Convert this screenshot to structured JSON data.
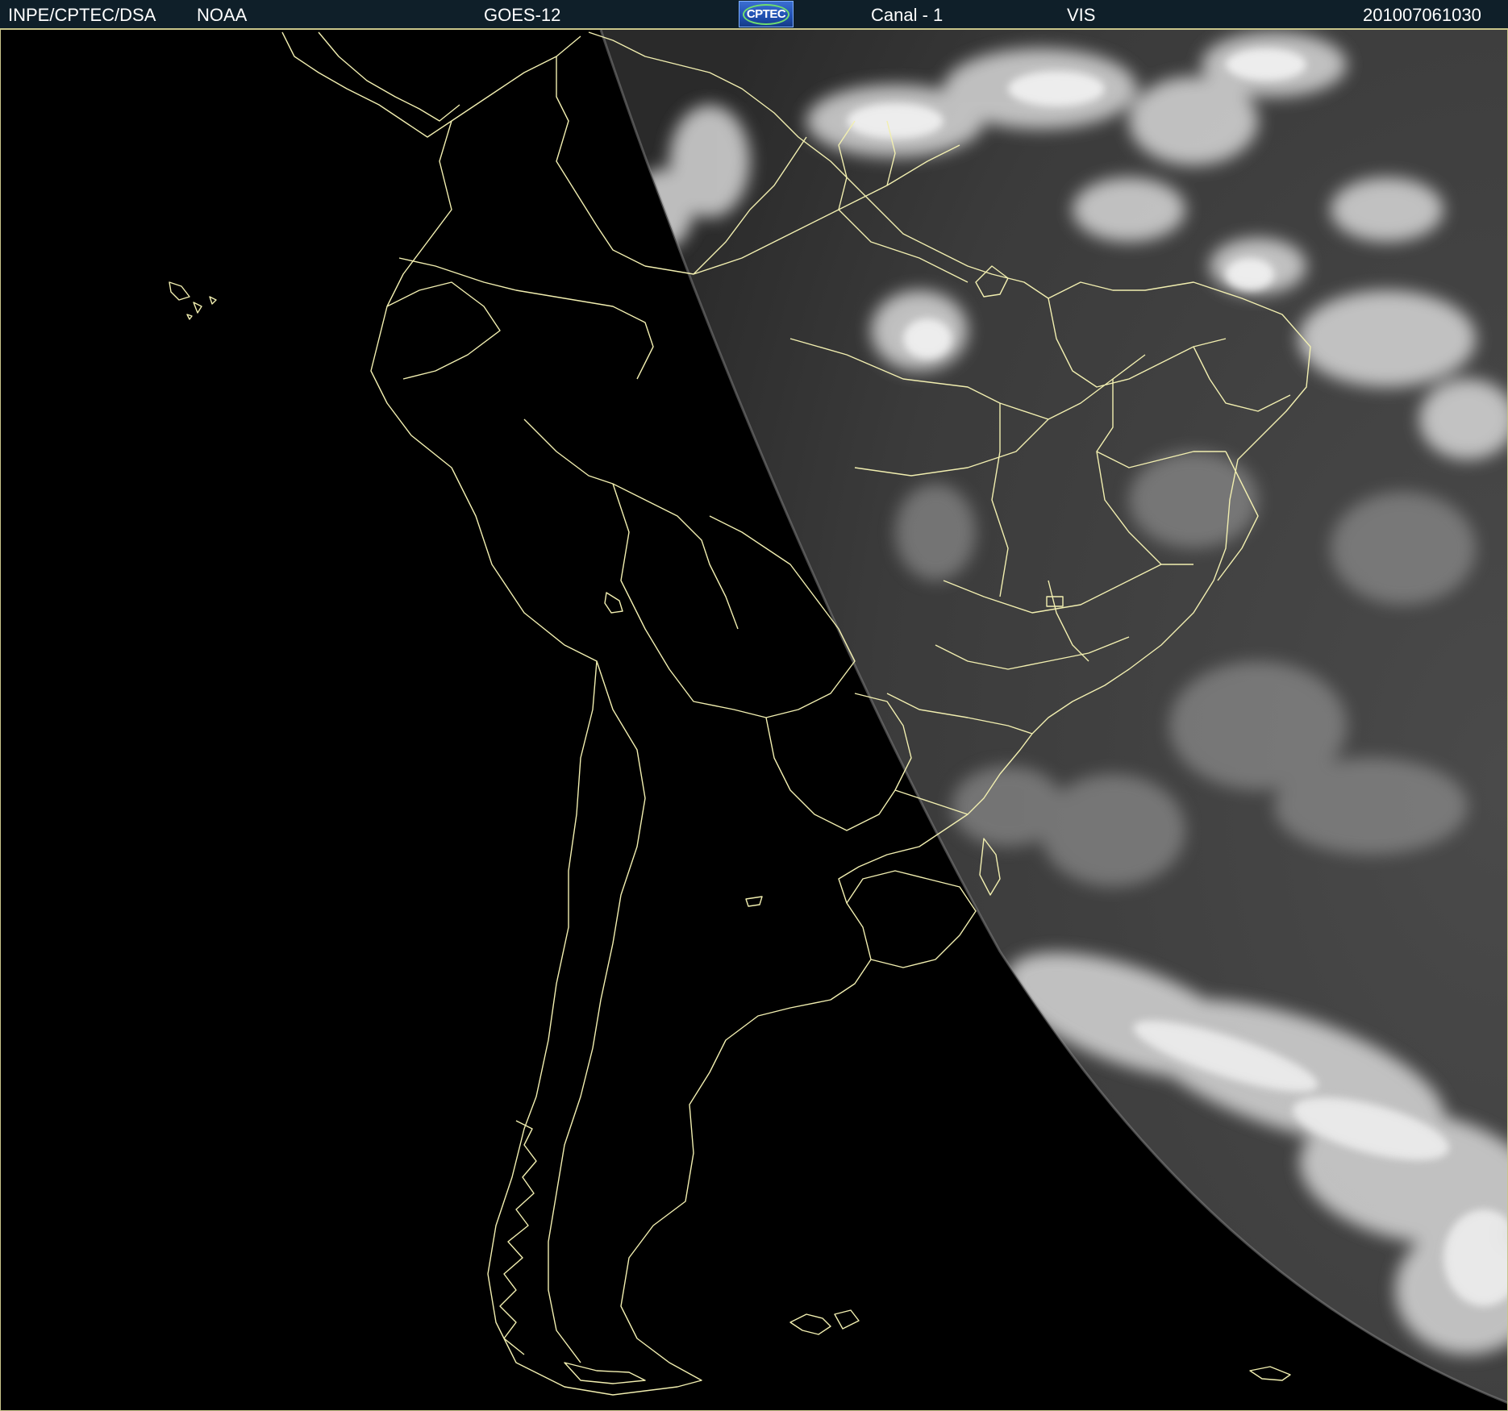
{
  "header": {
    "agency": "INPE/CPTEC/DSA",
    "operator": "NOAA",
    "satellite": "GOES-12",
    "logo_text": "CPTEC",
    "channel": "Canal - 1",
    "band": "VIS",
    "timestamp": "201007061030"
  },
  "colors": {
    "header_bg": "#0f1f29",
    "coastline": "#f2efb0",
    "night_side": "#000000",
    "day_side": "#3c3c3c",
    "clouds": "#e6e6e6"
  },
  "map": {
    "region": "South America",
    "image_type": "visible satellite image with political boundaries",
    "icons": [
      "cptec-logo-icon"
    ]
  }
}
